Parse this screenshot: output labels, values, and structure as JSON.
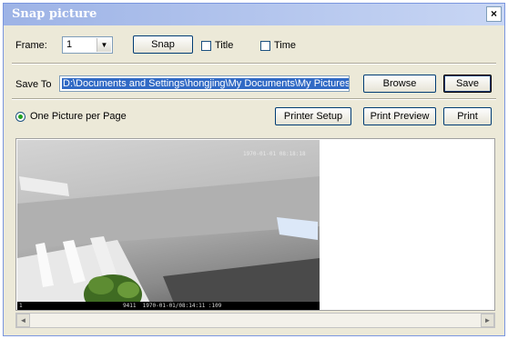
{
  "window": {
    "title": "Snap picture",
    "close_glyph": "×"
  },
  "frame": {
    "label": "Frame:",
    "selected": "1",
    "arrow_glyph": "▼"
  },
  "snap_button": "Snap",
  "title_checkbox": {
    "label": "Title",
    "checked": false
  },
  "time_checkbox": {
    "label": "Time",
    "checked": false
  },
  "save_to": {
    "label": "Save To",
    "path": "D:\\Documents and Settings\\hongjing\\My Documents\\My Pictures"
  },
  "browse_button": "Browse",
  "save_button": "Save",
  "layout_option": {
    "label": "One Picture per Page",
    "selected": true
  },
  "printer_setup_button": "Printer Setup",
  "print_preview_button": "Print Preview",
  "print_button": "Print",
  "preview": {
    "overlay_timestamp": "1970-01-01 08:18:18",
    "footer_index": "1",
    "footer_info": "9411  1970-01-01/08:14:11 :109"
  },
  "scrollbar": {
    "left_glyph": "◄",
    "right_glyph": "►"
  }
}
